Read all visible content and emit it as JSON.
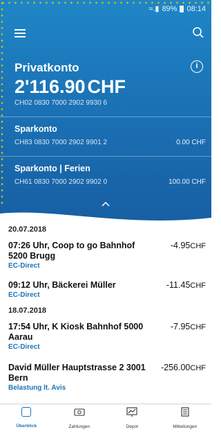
{
  "status": {
    "signal": "≈.▮",
    "battery": "89%",
    "time": "08:14"
  },
  "header": {
    "menu_icon": "menu-icon",
    "search_icon": "search-icon"
  },
  "account": {
    "name": "Privatkonto",
    "balance": "2'116.90",
    "currency": "CHF",
    "iban": "CH02 0830 7000 2902 9930 6"
  },
  "sub_accounts": [
    {
      "name": "Sparkonto",
      "iban": "CH83 0830 7000 2902 9901 2",
      "amount": "0.00 CHF"
    },
    {
      "name": "Sparkonto | Ferien",
      "iban": "CH61 0830 7000 2902 9902 0",
      "amount": "100.00 CHF"
    }
  ],
  "transactions": [
    {
      "date": "20.07.2018"
    },
    {
      "desc": "07:26 Uhr, Coop to go Bahnhof 5200 Brugg",
      "type": "EC-Direct",
      "amount": "-4.95",
      "currency": "CHF"
    },
    {
      "desc": "09:12 Uhr, Bäckerei Müller",
      "type": "EC-Direct",
      "amount": "-11.45",
      "currency": "CHF"
    },
    {
      "date": "18.07.2018"
    },
    {
      "desc": "17:54 Uhr, K Kiosk Bahnhof 5000 Aarau",
      "type": "EC-Direct",
      "amount": "-7.95",
      "currency": "CHF"
    },
    {
      "desc": "David Müller Hauptstrasse 2 3001 Bern",
      "type": "Belastung lt. Avis",
      "amount": "-256.00",
      "currency": "CHF"
    }
  ],
  "nav": [
    {
      "label": "Überblick",
      "icon": "overview-icon",
      "active": true
    },
    {
      "label": "Zahlungen",
      "icon": "payments-icon"
    },
    {
      "label": "Depot",
      "icon": "depot-icon"
    },
    {
      "label": "Mitteilungen",
      "icon": "messages-icon"
    }
  ],
  "colors": {
    "primary": "#1b73b6",
    "accent_dots": "#c9c21a"
  }
}
